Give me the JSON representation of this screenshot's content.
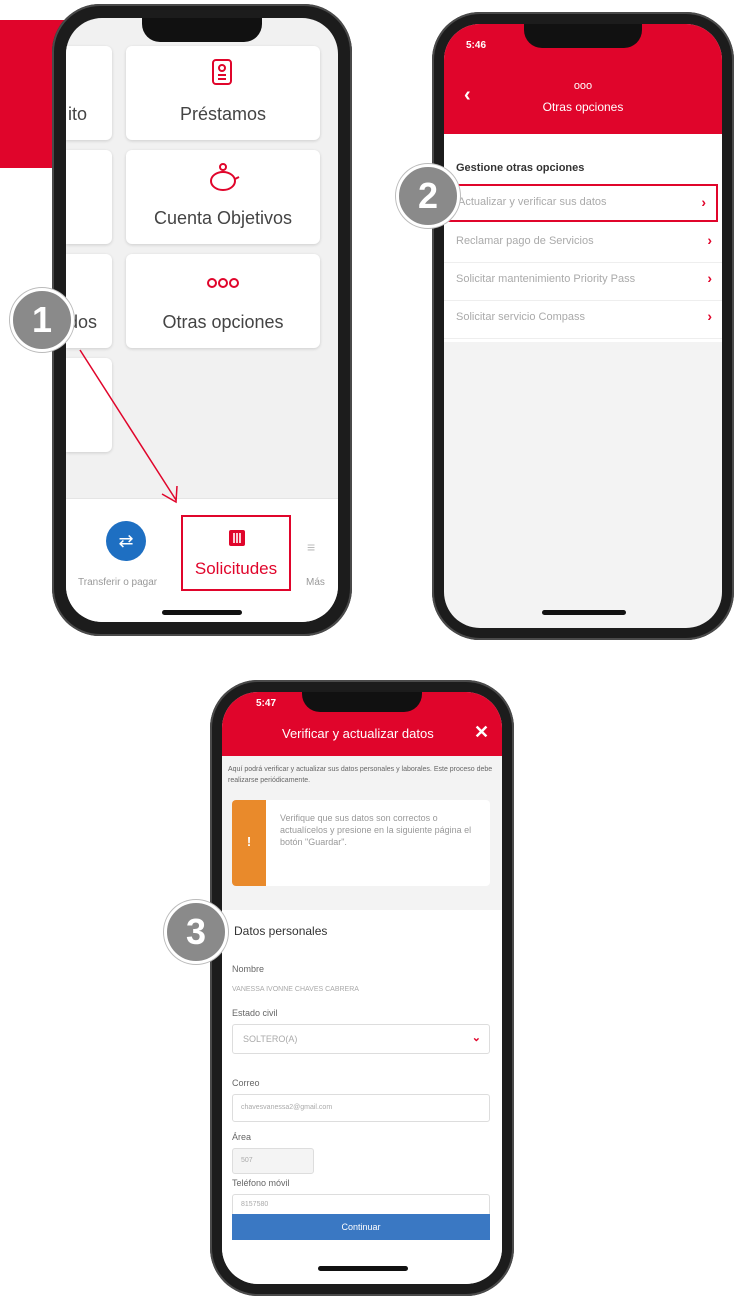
{
  "colors": {
    "brand_red": "#e0052b",
    "step_badge": "#8a8a8a",
    "fab_blue": "#1e6fc2",
    "warning_orange": "#e98a2b",
    "continue_blue": "#3a78c3"
  },
  "steps": [
    "1",
    "2",
    "3"
  ],
  "phone1": {
    "tiles": {
      "left_top": "ito",
      "prestamos": "Préstamos",
      "cuenta_objetivos": "Cuenta Objetivos",
      "left_mid": "dos",
      "otras_opciones": "Otras opciones"
    },
    "icons": {
      "prestamos": "document-icon",
      "objetivos": "piggy-bank-icon",
      "otras": "three-dots-icon"
    },
    "nav": {
      "transferir": "Transferir o pagar",
      "solicitudes": "Solicitudes",
      "mas": "Más"
    }
  },
  "phone2": {
    "status_time": "5:46",
    "header_icon": "ooo",
    "header_title": "Otras opciones",
    "section_title": "Gestione otras opciones",
    "items": [
      {
        "label": "Actualizar y verificar sus datos"
      },
      {
        "label": "Reclamar pago de Servicios"
      },
      {
        "label": "Solicitar mantenimiento Priority Pass"
      },
      {
        "label": "Solicitar servicio Compass"
      }
    ]
  },
  "phone3": {
    "status_time": "5:47",
    "header_title": "Verificar y actualizar datos",
    "intro": "Aquí podrá verificar y actualizar sus datos personales y laborales. Este proceso debe realizarse periódicamente.",
    "warning": "Verifique que sus datos son correctos o actualícelos y presione en la siguiente página el botón \"Guardar\".",
    "section_title": "Datos personales",
    "fields": {
      "nombre_label": "Nombre",
      "nombre_value": "VANESSA IVONNE CHAVES CABRERA",
      "estado_label": "Estado civil",
      "estado_value": "SOLTERO(A)",
      "correo_label": "Correo",
      "correo_value": "chavesvanessa2@gmail.com",
      "area_label": "Área",
      "area_value": "507",
      "telefono_label": "Teléfono móvil",
      "telefono_value": "8157580"
    },
    "continue_label": "Continuar"
  }
}
